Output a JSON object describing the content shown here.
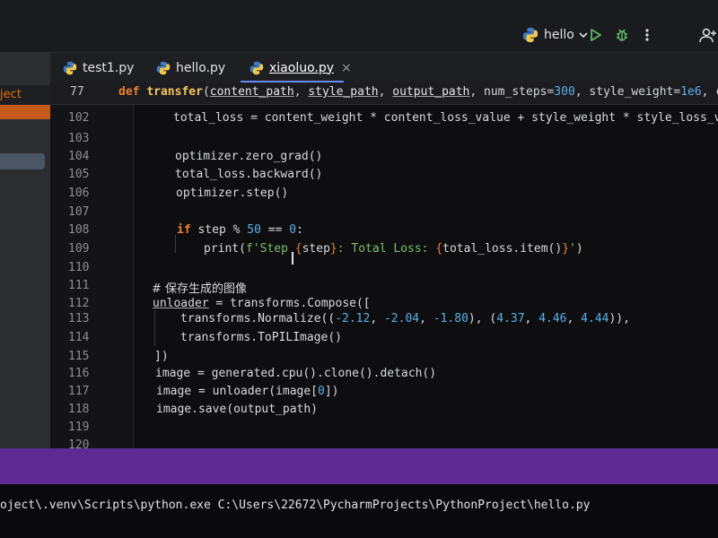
{
  "toolbar": {
    "run_config": "hello",
    "icons": [
      "python-icon",
      "chevron-down-icon",
      "run-icon",
      "debug-icon",
      "more-vertical-icon",
      "add-user-icon"
    ]
  },
  "tabs": [
    {
      "label": "test1.py"
    },
    {
      "label": "hello.py"
    },
    {
      "label": "xiaoluo.py",
      "close": "×"
    }
  ],
  "project": {
    "header": "ject"
  },
  "sticky": {
    "line": "77",
    "def": "def",
    "name": "transfer",
    "lp": "(",
    "p1": "content_path",
    "c1": ", ",
    "p2": "style_path",
    "c2": ", ",
    "p3": "output_path",
    "c3": ", num_steps=",
    "v1": "300",
    "c4": ", style_weight=",
    "v2": "1e6",
    "c5": ", content_"
  },
  "code": {
    "l102": {
      "num": "102",
      "text": "total_loss = content_weight * content_loss_value + style_weight * style_loss_value"
    },
    "l103": {
      "num": "103"
    },
    "l104": {
      "num": "104",
      "text": "optimizer.zero_grad()"
    },
    "l105": {
      "num": "105",
      "text": "total_loss.backward()"
    },
    "l106": {
      "num": "106",
      "text": "optimizer.step()"
    },
    "l107": {
      "num": "107"
    },
    "l108": {
      "num": "108",
      "kw": "if",
      "a": " step % ",
      "n1": "50",
      "b": " == ",
      "n2": "0",
      "c": ":"
    },
    "l109": {
      "num": "109",
      "pre": "print(",
      "s1": "f'Step ",
      "o1": "{",
      "e1": "step",
      "o2": "}",
      "s2": ": Total Loss: ",
      "o3": "{",
      "e2": "total_loss.item()",
      "o4": "}",
      "s3": "'",
      "post": ")"
    },
    "l110": {
      "num": "110"
    },
    "l111": {
      "num": "111",
      "text": "# 保存生成的图像"
    },
    "l112": {
      "num": "112",
      "u": "unloader",
      "rest": " = transforms.Compose(["
    },
    "l113": {
      "num": "113",
      "pre": "transforms.Normalize((",
      "n1": "-2.12",
      "c1": ", ",
      "n2": "-2.04",
      "c2": ", ",
      "n3": "-1.80",
      "c3": "), (",
      "n4": "4.37",
      "c4": ", ",
      "n5": "4.46",
      "c5": ", ",
      "n6": "4.44",
      "c6": ")),"
    },
    "l114": {
      "num": "114",
      "text": "transforms.ToPILImage()"
    },
    "l115": {
      "num": "115",
      "text": "])"
    },
    "l116": {
      "num": "116",
      "text": "image = generated.cpu().clone().detach()"
    },
    "l117": {
      "num": "117",
      "pre": "image = unloader(image[",
      "n": "0",
      "post": "])"
    },
    "l118": {
      "num": "118",
      "text": "image.save(output_path)"
    },
    "l119": {
      "num": "119"
    },
    "l120": {
      "num": "120"
    }
  },
  "terminal": {
    "text": "oject\\.venv\\Scripts\\python.exe C:\\Users\\22672\\PycharmProjects\\PythonProject\\hello.py"
  },
  "colors": {
    "accent": "#6a8cff",
    "keyword": "#e8802f",
    "function": "#f2c55c",
    "string": "#7fbf6a",
    "number": "#5ab0e6",
    "bottom_strip": "#5d2a94"
  }
}
